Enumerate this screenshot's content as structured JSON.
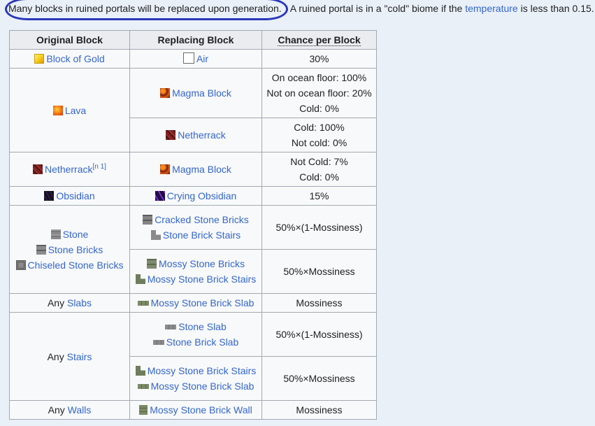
{
  "intro": {
    "circled_text": "Many blocks in ruined portals will be replaced upon generation.",
    "text_before_link": " A ruined portal is in a \"cold\" biome if the ",
    "link": "temperature",
    "text_after_link": " is less than 0.15."
  },
  "table": {
    "headers": [
      "Original Block",
      "Replacing Block",
      "Chance per Block"
    ],
    "gold": {
      "original": "Block of Gold",
      "replacing": "Air",
      "chance": "30%"
    },
    "lava": {
      "original": "Lava",
      "magma": "Magma Block",
      "magma_chances": [
        "On ocean floor: 100%",
        "Not on ocean floor: 20%",
        "Cold: 0%"
      ],
      "netherrack": "Netherrack",
      "netherrack_chances": [
        "Cold: 100%",
        "Not cold: 0%"
      ]
    },
    "netherrack": {
      "original": "Netherrack",
      "note": "[n 1]",
      "replacing": "Magma Block",
      "chances": [
        "Not Cold: 7%",
        "Cold: 0%"
      ]
    },
    "obsidian": {
      "original": "Obsidian",
      "replacing": "Crying Obsidian",
      "chance": "15%"
    },
    "stone_group": {
      "originals": [
        "Stone",
        "Stone Bricks",
        "Chiseled Stone Bricks"
      ],
      "r1": [
        "Cracked Stone Bricks",
        "Stone Brick Stairs"
      ],
      "r1_chance": "50%×(1-Mossiness)",
      "r2": [
        "Mossy Stone Bricks",
        "Mossy Stone Brick Stairs"
      ],
      "r2_chance": "50%×Mossiness"
    },
    "slabs": {
      "prefix": "Any ",
      "link": "Slabs",
      "replacing": "Mossy Stone Brick Slab",
      "chance": "Mossiness"
    },
    "stairs": {
      "prefix": "Any ",
      "link": "Stairs",
      "r1": [
        "Stone Slab",
        "Stone Brick Slab"
      ],
      "r1_chance": "50%×(1-Mossiness)",
      "r2": [
        "Mossy Stone Brick Stairs",
        "Mossy Stone Brick Slab"
      ],
      "r2_chance": "50%×Mossiness"
    },
    "walls": {
      "prefix": "Any ",
      "link": "Walls",
      "replacing": "Mossy Stone Brick Wall",
      "chance": "Mossiness"
    }
  }
}
